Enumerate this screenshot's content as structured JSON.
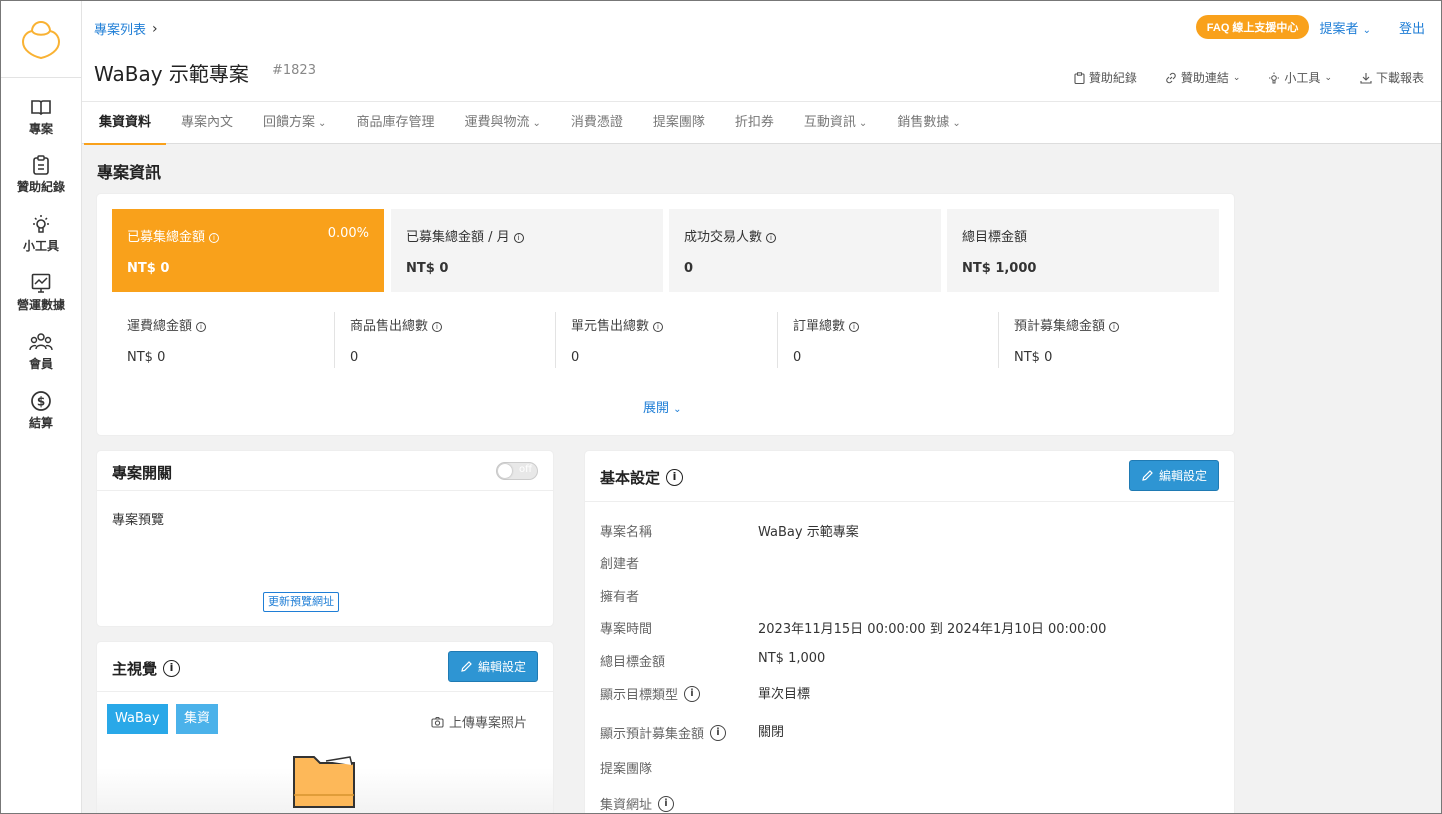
{
  "sidebar": {
    "items": [
      {
        "label": "專案",
        "icon": "book-icon"
      },
      {
        "label": "贊助紀錄",
        "icon": "clipboard-icon"
      },
      {
        "label": "小工具",
        "icon": "lightbulb-icon"
      },
      {
        "label": "營運數據",
        "icon": "chart-icon"
      },
      {
        "label": "會員",
        "icon": "users-icon"
      },
      {
        "label": "結算",
        "icon": "dollar-icon"
      }
    ]
  },
  "header": {
    "breadcrumb": "專案列表",
    "title": "WaBay 示範專案",
    "id": "#1823",
    "faq": "FAQ 線上支援中心",
    "proposer": "提案者",
    "logout": "登出",
    "tools": [
      "贊助紀錄",
      "贊助連結",
      "小工具",
      "下載報表"
    ]
  },
  "tabs": [
    "集資資料",
    "專案內文",
    "回饋方案",
    "商品庫存管理",
    "運費與物流",
    "消費憑證",
    "提案團隊",
    "折扣券",
    "互動資訊",
    "銷售數據"
  ],
  "tabs_dropdown": [
    false,
    false,
    true,
    false,
    true,
    false,
    false,
    false,
    true,
    true
  ],
  "info": {
    "title": "專案資訊",
    "top": [
      {
        "label": "已募集總金額",
        "value": "NT$ 0",
        "pct": "0.00%"
      },
      {
        "label": "已募集總金額 / 月",
        "value": "NT$ 0"
      },
      {
        "label": "成功交易人數",
        "value": "0"
      },
      {
        "label": "總目標金額",
        "value": "NT$ 1,000"
      }
    ],
    "bottom": [
      {
        "label": "運費總金額",
        "value": "NT$ 0"
      },
      {
        "label": "商品售出總數",
        "value": "0"
      },
      {
        "label": "單元售出總數",
        "value": "0"
      },
      {
        "label": "訂單總數",
        "value": "0"
      },
      {
        "label": "預計募集總金額",
        "value": "NT$ 0"
      }
    ],
    "expand": "展開"
  },
  "switch": {
    "title": "專案開關",
    "toggle": "off",
    "preview": "專案預覽",
    "update": "更新預覽網址"
  },
  "visual": {
    "title": "主視覺",
    "edit": "編輯設定",
    "tags": [
      "WaBay",
      "集資"
    ],
    "upload": "上傳專案照片"
  },
  "basic": {
    "title": "基本設定",
    "edit": "編輯設定",
    "rows": [
      {
        "label": "專案名稱",
        "value": "WaBay 示範專案"
      },
      {
        "label": "創建者",
        "value": ""
      },
      {
        "label": "擁有者",
        "value": ""
      },
      {
        "label": "專案時間",
        "value": "2023年11月15日 00:00:00 到 2024年1月10日 00:00:00"
      },
      {
        "label": "總目標金額",
        "value": "NT$ 1,000"
      },
      {
        "label": "顯示目標類型",
        "value": "單次目標"
      },
      {
        "label": "顯示預計募集金額",
        "value": "關閉"
      },
      {
        "label": "提案團隊",
        "value": ""
      },
      {
        "label": "集資網址",
        "value": ""
      }
    ]
  },
  "colors": {
    "accent": "#f9a11b",
    "link": "#1f7ed6",
    "button": "#2e95d3",
    "tag": "#29a8e8"
  }
}
